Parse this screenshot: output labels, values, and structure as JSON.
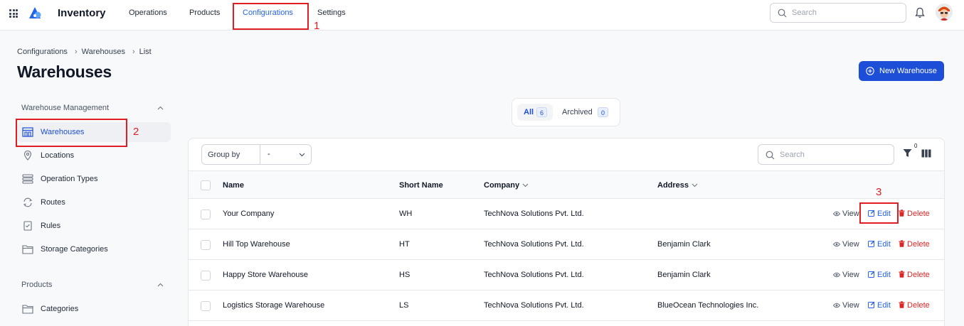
{
  "topbar": {
    "app_name": "Inventory",
    "nav": [
      "Operations",
      "Products",
      "Configurations",
      "Settings"
    ],
    "active_nav": "Configurations",
    "search_placeholder": "Search"
  },
  "breadcrumb": [
    "Configurations",
    "Warehouses",
    "List"
  ],
  "page_title": "Warehouses",
  "new_button_label": "New Warehouse",
  "sidebar": {
    "sections": [
      {
        "title": "Warehouse Management",
        "items": [
          {
            "label": "Warehouses",
            "icon": "warehouse-icon",
            "active": true
          },
          {
            "label": "Locations",
            "icon": "location-pin-icon"
          },
          {
            "label": "Operation Types",
            "icon": "list-icon"
          },
          {
            "label": "Routes",
            "icon": "routes-icon"
          },
          {
            "label": "Rules",
            "icon": "rules-icon"
          },
          {
            "label": "Storage Categories",
            "icon": "folder-icon"
          }
        ]
      },
      {
        "title": "Products",
        "items": [
          {
            "label": "Categories",
            "icon": "folder-icon"
          }
        ]
      }
    ]
  },
  "filter_tabs": [
    {
      "label": "All",
      "count": "6",
      "active": true
    },
    {
      "label": "Archived",
      "count": "0"
    }
  ],
  "toolbar": {
    "group_by_label": "Group by",
    "group_by_value": "-",
    "search_placeholder": "Search",
    "filter_count": "0"
  },
  "table": {
    "columns": [
      "Name",
      "Short Name",
      "Company",
      "Address"
    ],
    "rows": [
      {
        "name": "Your Company",
        "short": "WH",
        "company": "TechNova Solutions Pvt. Ltd.",
        "address": ""
      },
      {
        "name": "Hill Top Warehouse",
        "short": "HT",
        "company": "TechNova Solutions Pvt. Ltd.",
        "address": "Benjamin Clark"
      },
      {
        "name": "Happy Store Warehouse",
        "short": "HS",
        "company": "TechNova Solutions Pvt. Ltd.",
        "address": "Benjamin Clark"
      },
      {
        "name": "Logistics Storage Warehouse",
        "short": "LS",
        "company": "TechNova Solutions Pvt. Ltd.",
        "address": "BlueOcean Technologies Inc."
      }
    ],
    "actions": {
      "view": "View",
      "edit": "Edit",
      "delete": "Delete"
    }
  },
  "annotations": [
    "1",
    "2",
    "3"
  ],
  "colors": {
    "accent": "#1d4ed8",
    "annotation": "#e11d24",
    "delete": "#dc2626"
  }
}
